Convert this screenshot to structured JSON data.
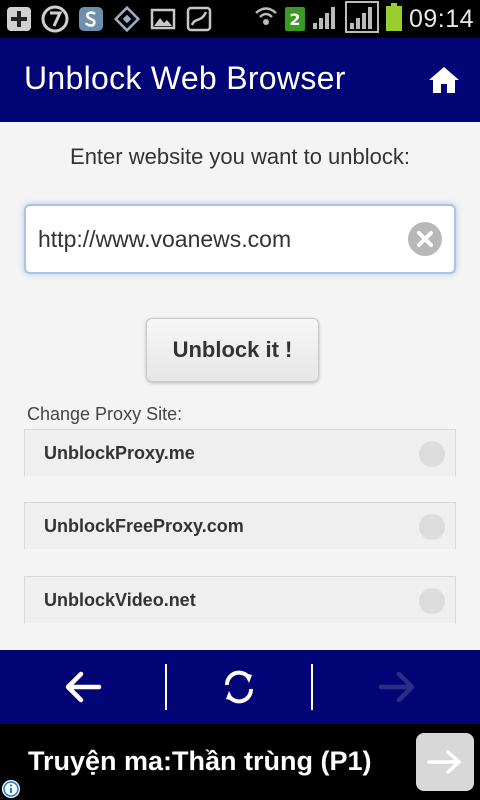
{
  "status_bar": {
    "time": "09:14",
    "notification_badge": "2",
    "icons": [
      "plus-icon",
      "seven-icon",
      "skype-icon",
      "diamond-icon",
      "gallery-icon",
      "map-icon",
      "wifi-icon",
      "signal-icon",
      "signal-icon",
      "battery-icon"
    ]
  },
  "header": {
    "title": "Unblock Web Browser",
    "home_icon": "home-icon",
    "background": "#020575"
  },
  "main": {
    "prompt": "Enter website you want to unblock:",
    "url_value": "http://www.voanews.com",
    "submit_label": "Unblock it !",
    "proxy_label": "Change Proxy Site:",
    "proxies": [
      {
        "name": "UnblockProxy.me"
      },
      {
        "name": "UnblockFreeProxy.com"
      },
      {
        "name": "UnblockVideo.net"
      }
    ]
  },
  "nav": {
    "back_icon": "arrow-left-icon",
    "refresh_icon": "refresh-icon",
    "forward_icon": "arrow-right-icon"
  },
  "ad": {
    "text": "Truyện ma:Thần trùng (P1)",
    "arrow_icon": "arrow-right-icon",
    "info_icon": "info-icon"
  }
}
